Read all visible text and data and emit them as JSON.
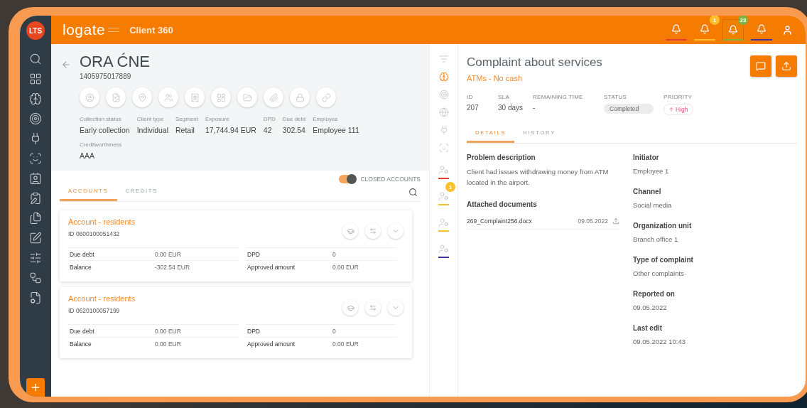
{
  "app": {
    "logo_badge": "LTS",
    "brand": "logate",
    "module": "Client 360"
  },
  "notifications": [
    {
      "color": "#e53935",
      "selected": false
    },
    {
      "color": "#fbc02d",
      "badge": "1",
      "selected": false
    },
    {
      "color": "#7cb342",
      "badge": "23",
      "selected": true
    },
    {
      "color": "#4a2fa0",
      "selected": false
    }
  ],
  "client": {
    "name": "ORA ĆNE",
    "number": "1405975017889",
    "fields": [
      {
        "label": "Collection status",
        "value": "Early collection"
      },
      {
        "label": "Client type",
        "value": "Individual"
      },
      {
        "label": "Segment",
        "value": "Retail"
      },
      {
        "label": "Exposure",
        "value": "17,744.94 EUR"
      },
      {
        "label": "DPD",
        "value": "42"
      },
      {
        "label": "Due debt",
        "value": "302.54"
      },
      {
        "label": "Employee",
        "value": "Employee 111"
      }
    ],
    "extra_fields": [
      {
        "label": "Creditworthiness",
        "value": "AAA"
      }
    ]
  },
  "closed_accounts": {
    "label": "CLOSED ACCOUNTS",
    "on": true
  },
  "tabs": [
    {
      "label": "ACCOUNTS",
      "selected": true
    },
    {
      "label": "CREDITS",
      "selected": false
    }
  ],
  "accounts": [
    {
      "title": "Account - residents",
      "id_label": "ID",
      "id": "0600100051432",
      "fields": [
        {
          "label": "Due debt",
          "value": "0.00 EUR"
        },
        {
          "label": "DPD",
          "value": "0"
        },
        {
          "label": "Balance",
          "value": "-302.54 EUR"
        },
        {
          "label": "Approved amount",
          "value": "0.00 EUR"
        }
      ]
    },
    {
      "title": "Account - residents",
      "id_label": "ID",
      "id": "0620100057199",
      "fields": [
        {
          "label": "Due debt",
          "value": "0.00 EUR"
        },
        {
          "label": "DPD",
          "value": "0"
        },
        {
          "label": "Balance",
          "value": "0.00 EUR"
        },
        {
          "label": "Approved amount",
          "value": "0.00 EUR"
        }
      ]
    }
  ],
  "strip": [
    {
      "selected": false
    },
    {
      "selected": true
    },
    {
      "selected": false
    },
    {
      "selected": false
    },
    {
      "selected": false
    },
    {
      "selected": false
    }
  ],
  "people": [
    {
      "color": "#e53935"
    },
    {
      "color": "#fbc02d",
      "badge": "1"
    },
    {
      "color": "#fbc02d"
    },
    {
      "color": "#4a2fa0"
    }
  ],
  "complaint": {
    "title": "Complaint about services",
    "subtitle": "ATMs - No cash",
    "meta": [
      {
        "kind": "text",
        "label": "ID",
        "value": "207"
      },
      {
        "kind": "text",
        "label": "SLA",
        "value": "30 days"
      },
      {
        "kind": "text",
        "label": "REMAINING TIME",
        "value": "-"
      },
      {
        "kind": "status",
        "label": "STATUS",
        "value": "Completed"
      },
      {
        "kind": "priority",
        "label": "PRIORITY",
        "value": "High"
      }
    ],
    "tabs": [
      {
        "label": "DETAILS",
        "selected": true
      },
      {
        "label": "HISTORY",
        "selected": false
      }
    ],
    "description_label": "Problem description",
    "description": "Client had issues withdrawing money from ATM located in the airport.",
    "attachments_label": "Attached documents",
    "attachments": [
      {
        "name": "269_Complaint256.docx",
        "date": "09.05.2022"
      }
    ],
    "details": [
      {
        "label": "Initiator",
        "value": "Employee 1"
      },
      {
        "label": "Channel",
        "value": "Social media"
      },
      {
        "label": "Organization unit",
        "value": "Branch office 1"
      },
      {
        "label": "Type of complaint",
        "value": "Other complaints"
      },
      {
        "label": "Reported on",
        "value": "09.05.2022"
      },
      {
        "label": "Last edit",
        "value": "09.05.2022 10:43"
      }
    ]
  }
}
